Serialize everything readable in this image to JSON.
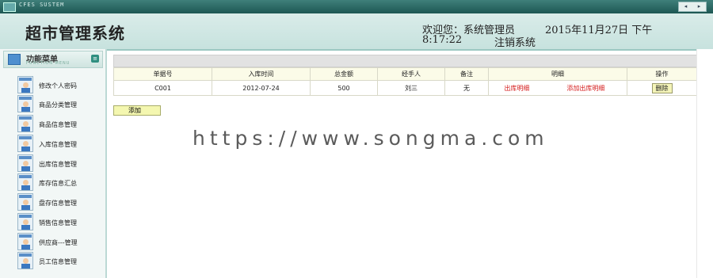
{
  "window": {
    "system_label": "CFES SUSTEM",
    "nav_prev": "◂",
    "nav_next": "▸"
  },
  "header": {
    "title": "超市管理系统",
    "welcome": "欢迎您：系统管理员",
    "date": "2015年11月27日 下午",
    "time": "8:17:22",
    "logout": "注销系统"
  },
  "sidebar": {
    "title": "功能菜单",
    "subtitle": "FUNCTION MENU",
    "toggle": "≡",
    "items": [
      {
        "label": "修改个人密码"
      },
      {
        "label": "商品分类管理"
      },
      {
        "label": "商品信息管理"
      },
      {
        "label": "入库信息管理"
      },
      {
        "label": "出库信息管理"
      },
      {
        "label": "库存信息汇总"
      },
      {
        "label": "盘存信息管理"
      },
      {
        "label": "销售信息管理"
      },
      {
        "label": "供应商---管理"
      },
      {
        "label": "员工信息管理"
      }
    ]
  },
  "table": {
    "headers": [
      "单据号",
      "入库时间",
      "总金额",
      "经手人",
      "备注",
      "明细",
      "操作"
    ],
    "rows": [
      {
        "id": "C001",
        "time": "2012-07-24",
        "amount": "500",
        "handler": "刘三",
        "note": "无",
        "detail": "出库明细",
        "add_detail": "添加出库明细",
        "action": "删除"
      }
    ]
  },
  "add_button": "添加",
  "watermark": "https://www.songma.com"
}
